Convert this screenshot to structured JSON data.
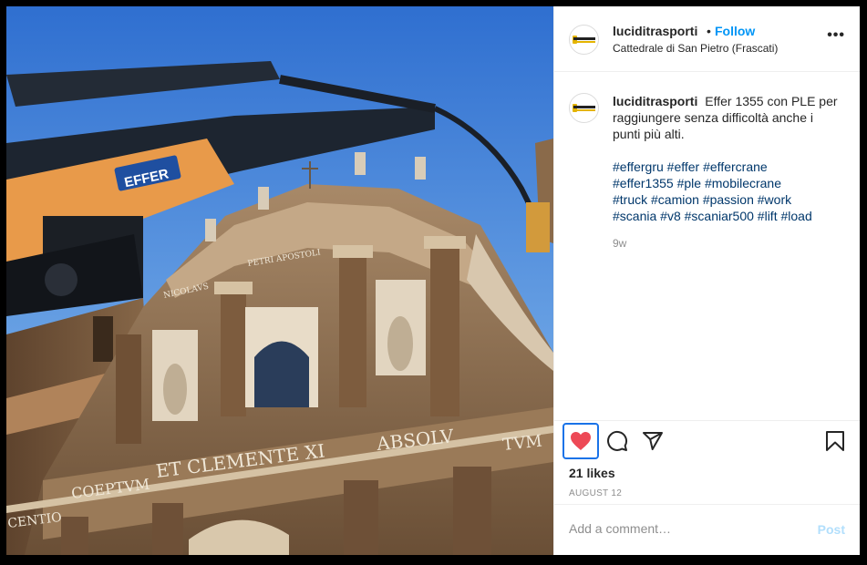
{
  "post": {
    "image_alt": "Effer crane arm next to baroque cathedral facade",
    "facade_text": {
      "line1": "ET CLEMENTE XI",
      "line2": "ABSOLV",
      "line3": "TVM",
      "line4": "COEPTVM",
      "line5": "CENTIO",
      "upper": "NICOLAVS",
      "upper2": "PETRI APOSTOLI",
      "crane_brand": "EFFER"
    }
  },
  "header": {
    "username": "luciditrasporti",
    "separator": "•",
    "follow_label": "Follow",
    "location": "Cattedrale di San Pietro (Frascati)",
    "more_label": "•••"
  },
  "caption": {
    "username": "luciditrasporti",
    "text": "Effer 1355 con PLE per raggiungere senza difficoltà anche i punti più alti.",
    "hashtags": [
      "#effergru",
      "#effer",
      "#effercrane",
      "#effer1355",
      "#ple",
      "#mobilecrane",
      "#truck",
      "#camion",
      "#passion",
      "#work",
      "#scania",
      "#v8",
      "#scaniar500",
      "#lift",
      "#load"
    ],
    "time": "9w"
  },
  "actions": {
    "likes": "21 likes",
    "date": "AUGUST 12",
    "liked": true,
    "heart_color": "#ed4956"
  },
  "comment": {
    "placeholder": "Add a comment…",
    "post_label": "Post"
  },
  "colors": {
    "accent": "#0095f6",
    "hashtag": "#00376b"
  }
}
